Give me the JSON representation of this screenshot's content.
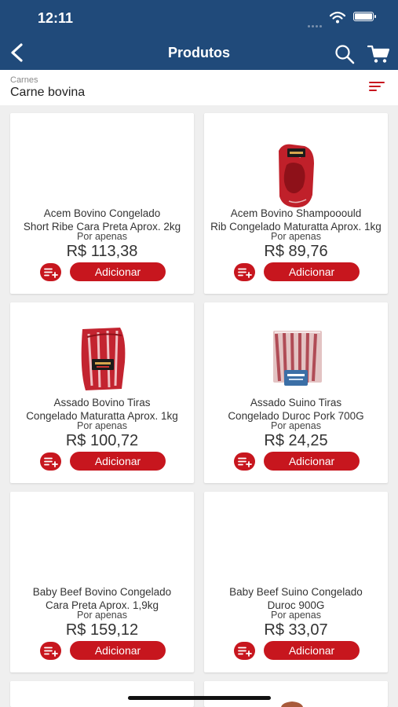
{
  "status": {
    "time": "12:11"
  },
  "header": {
    "title": "Produtos"
  },
  "filter": {
    "category": "Carnes",
    "subcategory": "Carne bovina"
  },
  "products": [
    {
      "name_line1": "Acem Bovino Congelado",
      "name_line2": "Short Ribe Cara Preta Aprox. 2kg",
      "por_apenas": "Por apenas",
      "price": "R$ 113,38",
      "add_label": "Adicionar",
      "image": "none"
    },
    {
      "name_line1": "Acem Bovino Shampooould",
      "name_line2": "Rib Congelado Maturatta Aprox. 1kg",
      "por_apenas": "Por apenas",
      "price": "R$ 89,76",
      "add_label": "Adicionar",
      "image": "beef-vacuum-pack"
    },
    {
      "name_line1": "Assado Bovino Tiras",
      "name_line2": "Congelado Maturatta Aprox. 1kg",
      "por_apenas": "Por apenas",
      "price": "R$ 100,72",
      "add_label": "Adicionar",
      "image": "beef-ribs-pack"
    },
    {
      "name_line1": "Assado Suino Tiras",
      "name_line2": "Congelado Duroc Pork 700G",
      "por_apenas": "Por apenas",
      "price": "R$ 24,25",
      "add_label": "Adicionar",
      "image": "pork-ribs-pack"
    },
    {
      "name_line1": "Baby Beef Bovino Congelado",
      "name_line2": "Cara Preta Aprox. 1,9kg",
      "por_apenas": "Por apenas",
      "price": "R$ 159,12",
      "add_label": "Adicionar",
      "image": "none"
    },
    {
      "name_line1": "Baby Beef Suino Congelado",
      "name_line2": "Duroc 900G",
      "por_apenas": "Por apenas",
      "price": "R$ 33,07",
      "add_label": "Adicionar",
      "image": "none"
    }
  ],
  "colors": {
    "header": "#204a7a",
    "accent": "#c7161e",
    "background": "#efefef"
  },
  "icons": {
    "back": "chevron-left-icon",
    "search": "search-icon",
    "cart": "cart-icon",
    "sort": "sort-icon",
    "add_to_list": "playlist-add-icon"
  }
}
